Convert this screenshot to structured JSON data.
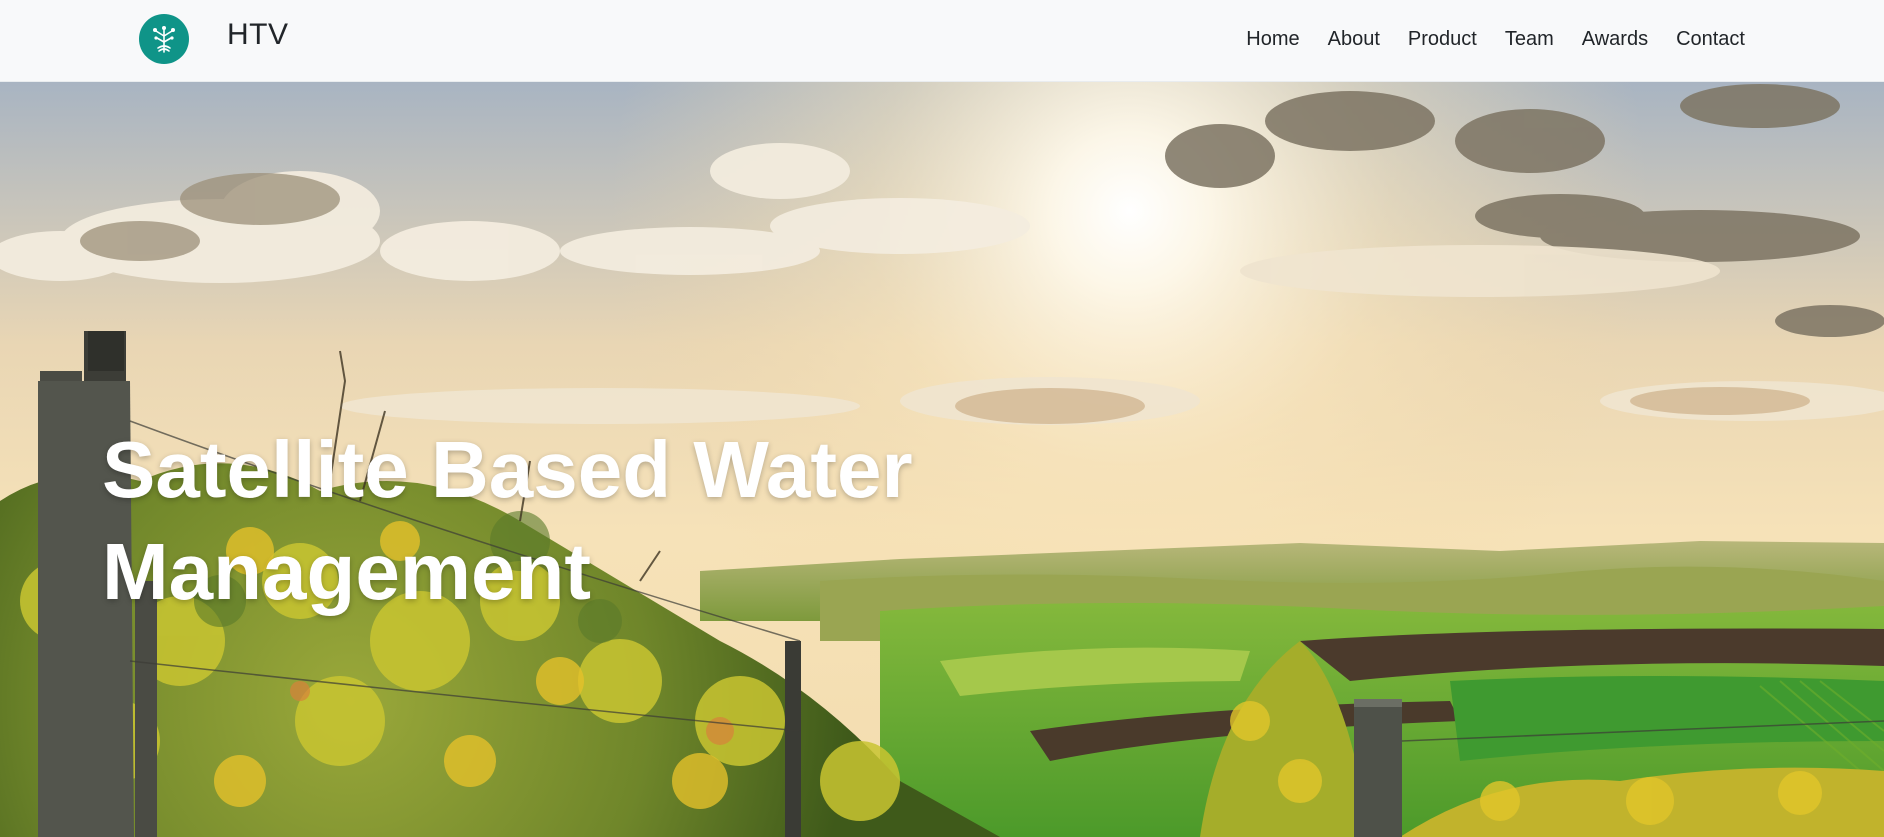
{
  "brand": {
    "name": "HTV",
    "logo_icon": "tree-circuit-logo-icon",
    "logo_color": "#0f9488"
  },
  "nav": {
    "items": [
      {
        "label": "Home"
      },
      {
        "label": "About"
      },
      {
        "label": "Product"
      },
      {
        "label": "Team"
      },
      {
        "label": "Awards"
      },
      {
        "label": "Contact"
      }
    ]
  },
  "hero": {
    "title_line1": "Satellite Based Water",
    "title_line2": "Management",
    "background": "vineyard-sunset-landscape-image"
  }
}
